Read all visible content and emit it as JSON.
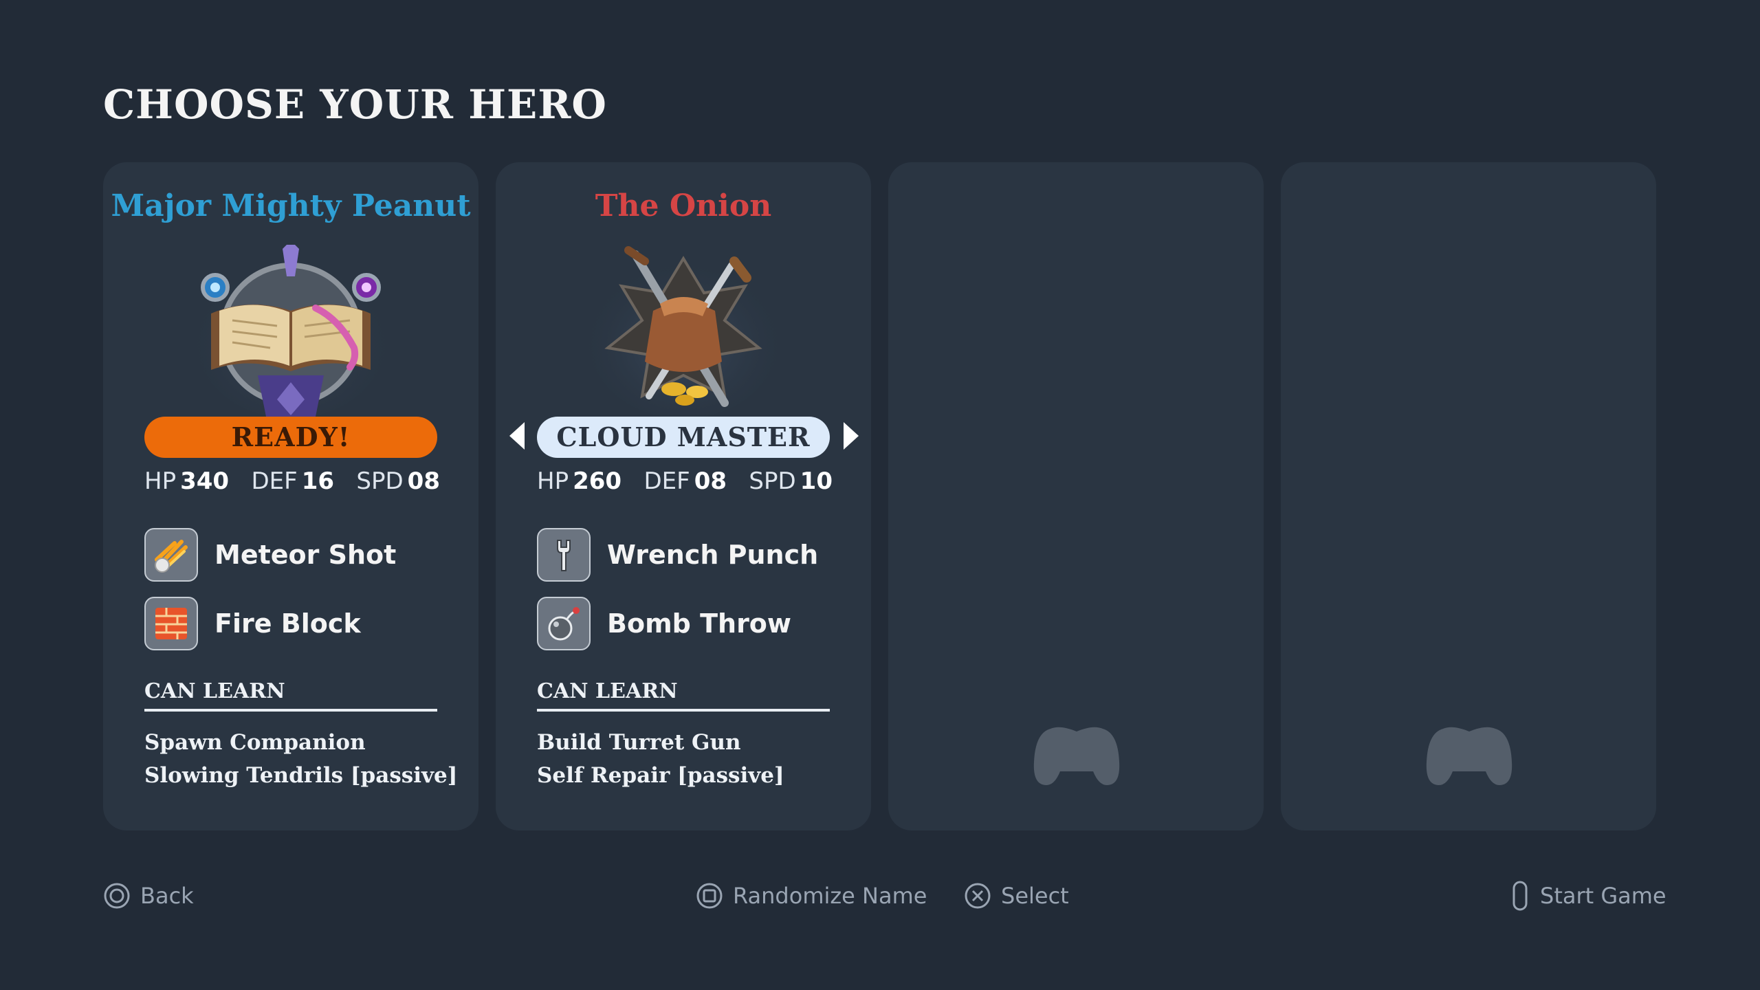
{
  "screen": {
    "title": "CHOOSE YOUR HERO"
  },
  "colors": {
    "background": "#222b37",
    "card": "#2a3542",
    "peanut_name": "#2f9fd4",
    "onion_name": "#d64545",
    "ready": "#ec6b0a",
    "class_pill": "#dceafa"
  },
  "heroes": [
    {
      "name": "Major Mighty Peanut",
      "portrait": "spellbook-emblem",
      "status": "READY!",
      "stats": {
        "hp_label": "HP",
        "hp": "340",
        "def_label": "DEF",
        "def": "16",
        "spd_label": "SPD",
        "spd": "08"
      },
      "abilities": [
        {
          "label": "Meteor Shot",
          "icon": "meteor-icon"
        },
        {
          "label": "Fire Block",
          "icon": "fire-wall-icon"
        }
      ],
      "can_learn_heading": "CAN LEARN",
      "can_learn": [
        "Spawn Companion",
        "Slowing Tendrils [passive]"
      ]
    },
    {
      "name": "The Onion",
      "portrait": "loot-bag-emblem",
      "class_selector": "CLOUD MASTER",
      "stats": {
        "hp_label": "HP",
        "hp": "260",
        "def_label": "DEF",
        "def": "08",
        "spd_label": "SPD",
        "spd": "10"
      },
      "abilities": [
        {
          "label": "Wrench Punch",
          "icon": "wrench-icon"
        },
        {
          "label": "Bomb Throw",
          "icon": "bomb-icon"
        }
      ],
      "can_learn_heading": "CAN LEARN",
      "can_learn": [
        "Build Turret Gun",
        "Self Repair [passive]"
      ]
    }
  ],
  "empty_slots": [
    {
      "icon": "gamepad-icon"
    },
    {
      "icon": "gamepad-icon"
    }
  ],
  "footer": {
    "back": "Back",
    "randomize": "Randomize Name",
    "select": "Select",
    "start": "Start Game"
  }
}
